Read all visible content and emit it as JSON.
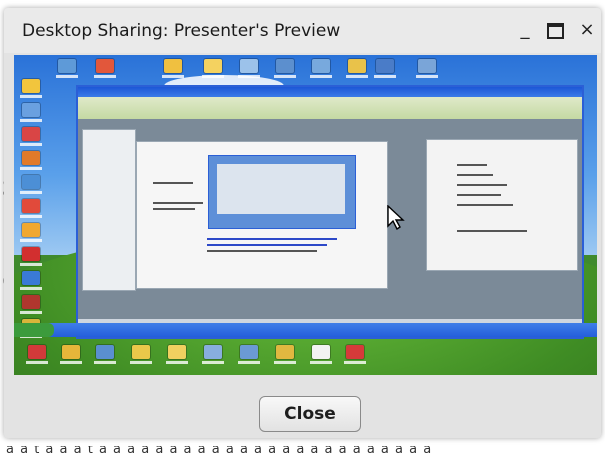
{
  "dialog": {
    "title": "Desktop Sharing: Presenter's Preview",
    "controls": {
      "minimize": "_",
      "maximize": "maximize",
      "close": "×"
    },
    "preview_alt": "shared desktop preview",
    "close_label": "Close"
  },
  "background": {
    "left_fragments": [
      "s",
      ":",
      "o",
      "p"
    ],
    "bottom_text": "a a t a a a t a  a a a a a  a a a a  a a a a  a a a a  a a a a a a"
  },
  "colors": {
    "titlebar": "#eaeaea",
    "dialog_bg": "#e3e3e3",
    "xp_blue": "#2b5fd6",
    "button_bg": "#efefef"
  },
  "icons": [
    "minimize-icon",
    "maximize-icon",
    "close-icon",
    "cursor-icon"
  ]
}
